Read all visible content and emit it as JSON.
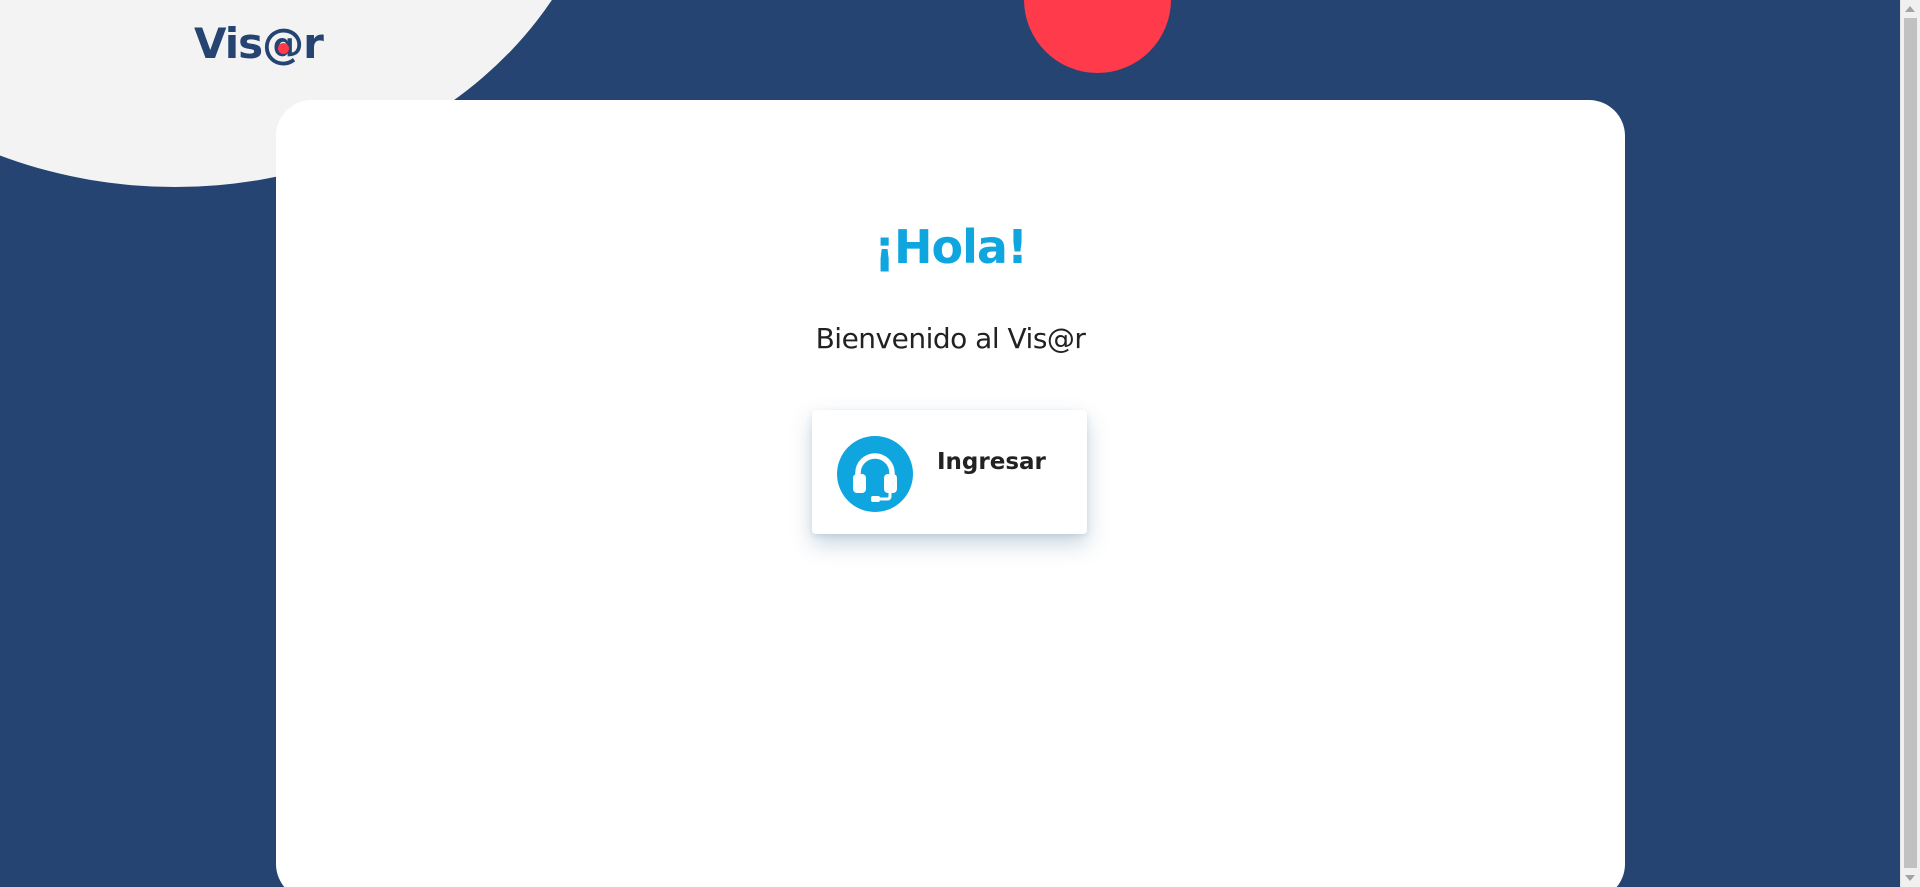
{
  "brand": {
    "logo_prefix": "Vis",
    "logo_at": "@",
    "logo_suffix": "r"
  },
  "welcome": {
    "greeting": "¡Hola!",
    "subtitle": "Bienvenido al Vis@r"
  },
  "actions": {
    "enter_label": "Ingresar",
    "enter_icon": "headset-icon"
  },
  "colors": {
    "background": "#254472",
    "accent": "#0fa6df",
    "red": "#ff3a4a",
    "card": "#ffffff"
  }
}
